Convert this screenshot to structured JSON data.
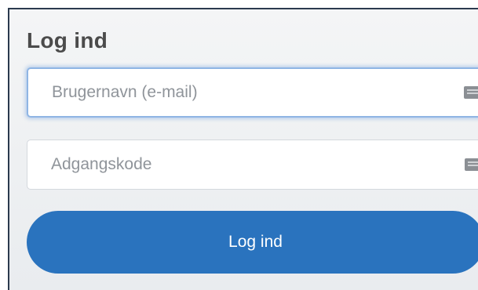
{
  "login": {
    "title": "Log ind",
    "username": {
      "placeholder": "Brugernavn (e-mail)",
      "value": ""
    },
    "password": {
      "placeholder": "Adgangskode",
      "value": ""
    },
    "submit_label": "Log ind",
    "icons": {
      "username_field": "keyboard-icon",
      "password_field": "keyboard-icon"
    },
    "colors": {
      "button": "#2a73be",
      "focus_ring": "#8fb5e4",
      "title": "#4b4b4b"
    }
  }
}
